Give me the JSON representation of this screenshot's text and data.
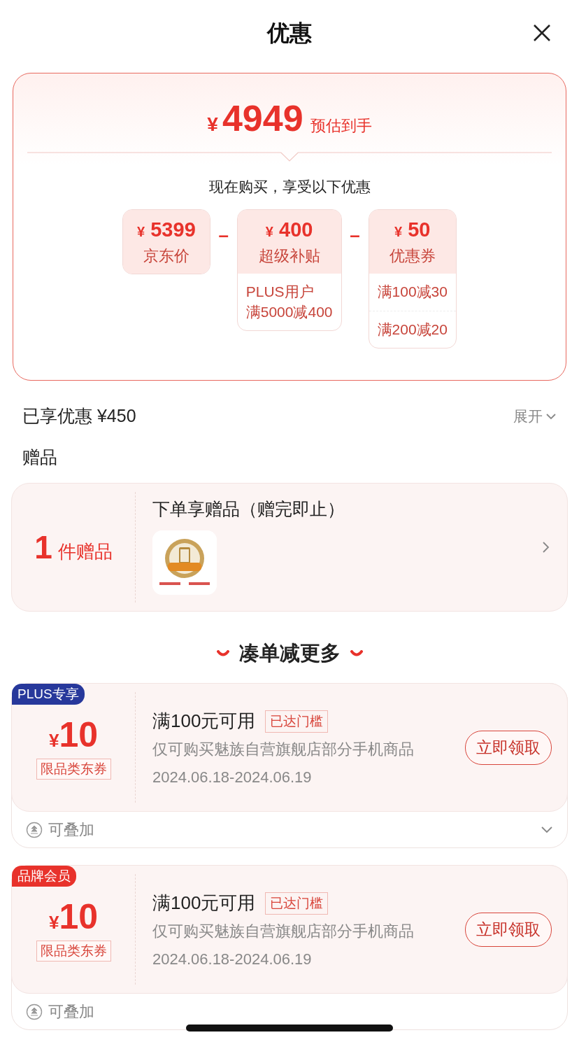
{
  "header": {
    "title": "优惠"
  },
  "estimate": {
    "currency": "¥",
    "amount": "4949",
    "label": "预估到手",
    "intro": "现在购买，享受以下优惠",
    "items": [
      {
        "currency": "¥",
        "amount": "5399",
        "label": "京东价"
      },
      {
        "operator": "–",
        "currency": "¥",
        "amount": "400",
        "label": "超级补贴",
        "details": [
          [
            "PLUS用户",
            "满5000减400"
          ]
        ]
      },
      {
        "operator": "–",
        "currency": "¥",
        "amount": "50",
        "label": "优惠券",
        "details": [
          [
            "满100减30"
          ],
          [
            "满200减20"
          ]
        ]
      }
    ]
  },
  "savings": {
    "label": "已享优惠 ¥450",
    "toggle": "展开"
  },
  "gifts": {
    "heading": "赠品",
    "count": "1",
    "unit": "件赠品",
    "title": "下单享赠品（赠完即止）"
  },
  "promo_heading": "凑单减更多",
  "coupons": [
    {
      "tag": {
        "label": "PLUS专享",
        "color": "#27389b"
      },
      "currency": "¥",
      "amount": "10",
      "scope": "限品类东券",
      "threshold": "满100元可用",
      "status": "已达门槛",
      "description": "仅可购买魅族自营旗舰店部分手机商品",
      "validity": "2024.06.18-2024.06.19",
      "action": "立即领取",
      "stack": "可叠加",
      "collapsible": true
    },
    {
      "tag": {
        "label": "品牌会员",
        "color": "#e8322b"
      },
      "currency": "¥",
      "amount": "10",
      "scope": "限品类东券",
      "threshold": "满100元可用",
      "status": "已达门槛",
      "description": "仅可购买魅族自营旗舰店部分手机商品",
      "validity": "2024.06.18-2024.06.19",
      "action": "立即领取",
      "stack": "可叠加",
      "collapsible": false
    }
  ]
}
